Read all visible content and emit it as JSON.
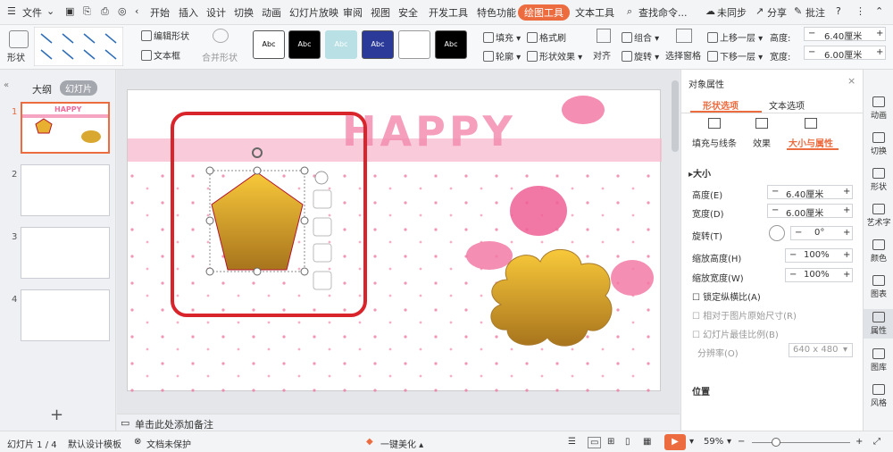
{
  "menubar": {
    "file": "文件",
    "tabs": [
      "开始",
      "插入",
      "设计",
      "切换",
      "动画",
      "幻灯片放映",
      "审阅",
      "视图",
      "安全",
      "开发工具",
      "特色功能",
      "绘图工具",
      "文本工具"
    ],
    "search": "查找命令...",
    "sync": "未同步",
    "share": "分享",
    "comment": "批注"
  },
  "ribbon": {
    "shape": "形状",
    "edit_shape": "编辑形状",
    "textbox": "文本框",
    "merge_shape": "合并形状",
    "swatch_label": "Abc",
    "fill": "填充",
    "outline": "轮廓",
    "format_painter": "格式刷",
    "shape_effect": "形状效果",
    "align": "对齐",
    "group": "组合",
    "rotate": "旋转",
    "selection_pane": "选择窗格",
    "bring_forward": "上移一层",
    "send_backward": "下移一层",
    "height_label": "高度:",
    "height_value": "6.40厘米",
    "width_label": "宽度:",
    "width_value": "6.00厘米"
  },
  "leftpanel": {
    "outline_tab": "大纲",
    "slides_tab": "幻灯片",
    "slide_numbers": [
      "1",
      "2",
      "3",
      "4"
    ],
    "happy_text": "HAPPY"
  },
  "canvas": {
    "slide_text": "HAPPY",
    "notes_placeholder": "单击此处添加备注"
  },
  "rpanel": {
    "title": "对象属性",
    "tab_shape": "形状选项",
    "tab_text": "文本选项",
    "sub_fill": "填充与线条",
    "sub_effect": "效果",
    "sub_size": "大小与属性",
    "section_size": "大小",
    "height_label": "高度(E)",
    "height_value": "6.40厘米",
    "width_label": "宽度(D)",
    "width_value": "6.00厘米",
    "rotate_label": "旋转(T)",
    "rotate_value": "0°",
    "scale_h_label": "缩放高度(H)",
    "scale_h_value": "100%",
    "scale_w_label": "缩放宽度(W)",
    "scale_w_value": "100%",
    "lock_ratio": "锁定纵横比(A)",
    "relative_original": "相对于图片原始尺寸(R)",
    "best_scale": "幻灯片最佳比例(B)",
    "resolution_label": "分辨率(O)",
    "resolution_value": "640 x 480",
    "position_label": "位置"
  },
  "rbar": {
    "items": [
      "动画",
      "切换",
      "形状",
      "艺术字",
      "颜色",
      "图表",
      "属性",
      "图库",
      "风格"
    ]
  },
  "status": {
    "slide_pos": "幻灯片 1 / 4",
    "template": "默认设计模板",
    "protect": "文档未保护",
    "beautify": "一键美化",
    "zoom": "59%"
  },
  "colors": {
    "accent": "#ec6b3f",
    "selection_highlight": "#d9242b",
    "pentagon_top": "#f8c93a",
    "pentagon_bottom": "#a8741d"
  }
}
